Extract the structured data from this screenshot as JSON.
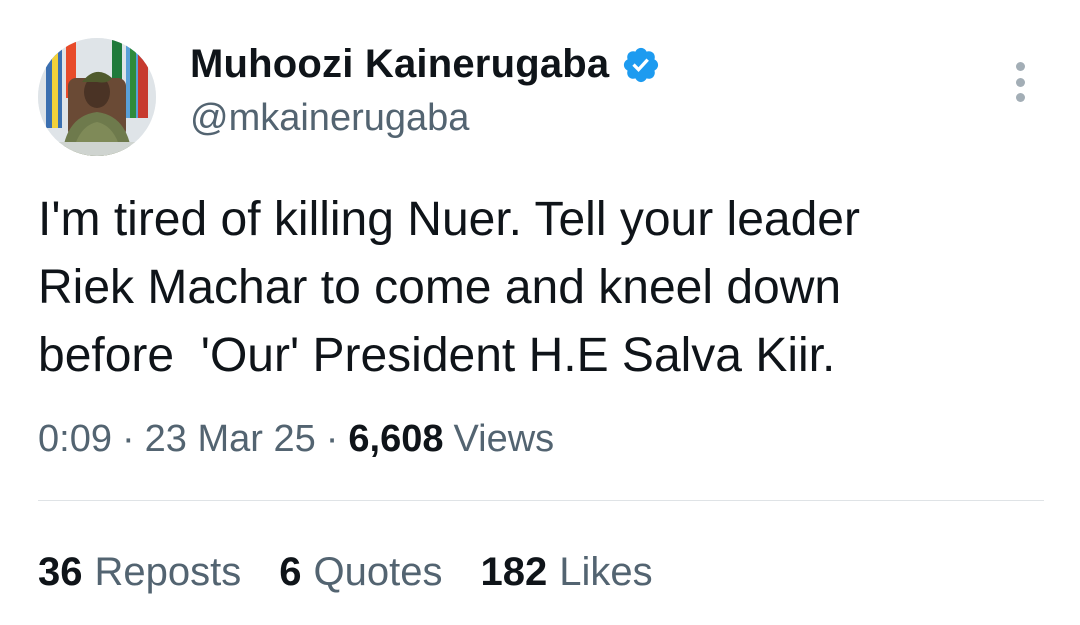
{
  "author": {
    "display_name": "Muhoozi Kainerugaba",
    "handle": "@mkainerugaba",
    "verified": true,
    "avatar_icon": "profile-photo",
    "verified_icon": "verified-badge-icon"
  },
  "menu": {
    "icon": "more-vertical-icon"
  },
  "tweet": {
    "text": "I'm tired of killing Nuer. Tell your leader\nRiek Machar to come and kneel down\nbefore  'Our' President H.E Salva Kiir."
  },
  "meta": {
    "time": "0:09",
    "separator": "·",
    "date": "23 Mar 25",
    "views_count": "6,608",
    "views_label": "Views"
  },
  "stats": {
    "reposts_count": "36",
    "reposts_label": "Reposts",
    "quotes_count": "6",
    "quotes_label": "Quotes",
    "likes_count": "182",
    "likes_label": "Likes"
  },
  "colors": {
    "text_primary": "#0f1419",
    "text_secondary": "#536471",
    "verified_blue": "#1d9bf0",
    "divider": "#dfe3e6"
  }
}
